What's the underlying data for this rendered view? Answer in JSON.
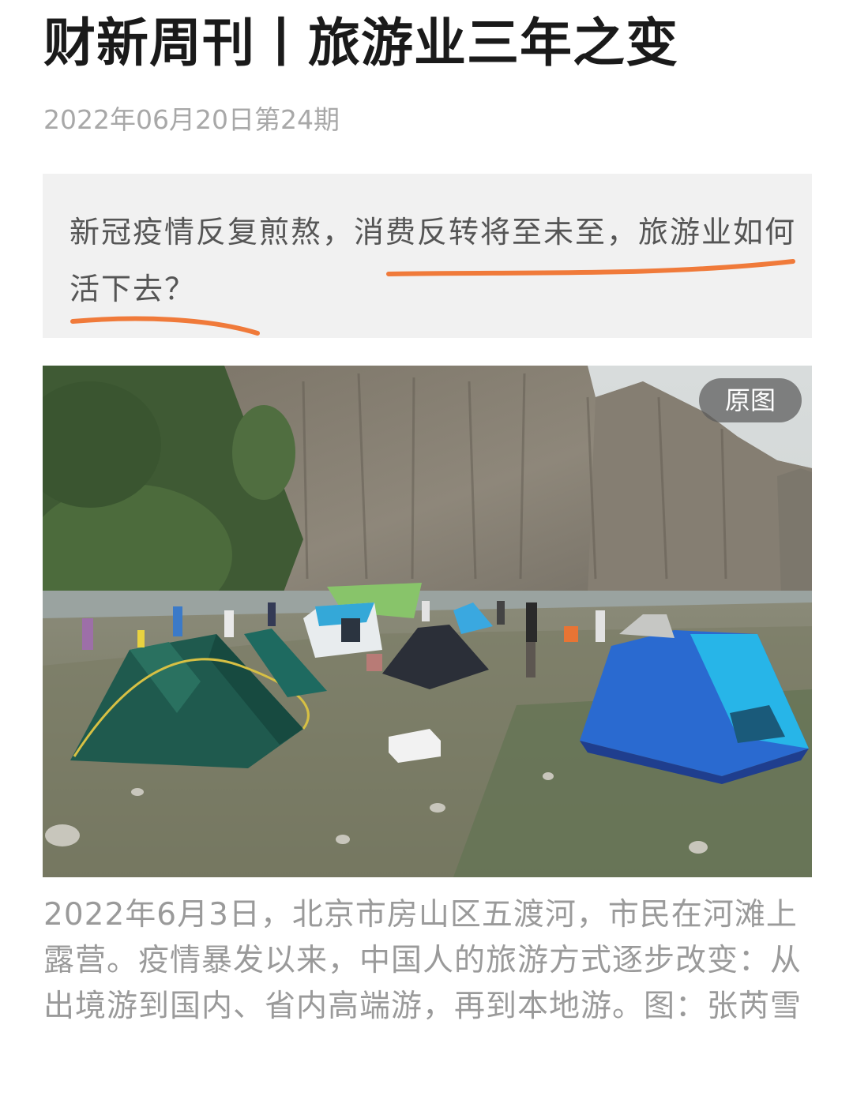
{
  "article": {
    "title": "财新周刊丨旅游业三年之变",
    "meta": "2022年06月20日第24期",
    "summary": "新冠疫情反复煎熬，消费反转将至未至，旅游业如何活下去？",
    "caption": "2022年6月3日，北京市房山区五渡河，市民在河滩上露营。疫情暴发以来，中国人的旅游方式逐步改变：从出境游到国内、省内高端游，再到本地游。图：张芮雪"
  },
  "photo": {
    "original_button": "原图"
  },
  "colors": {
    "underline": "#f07a3a",
    "summary_bg": "#f1f1f1",
    "meta": "#a8a8a8",
    "caption": "#9a9a9a"
  }
}
